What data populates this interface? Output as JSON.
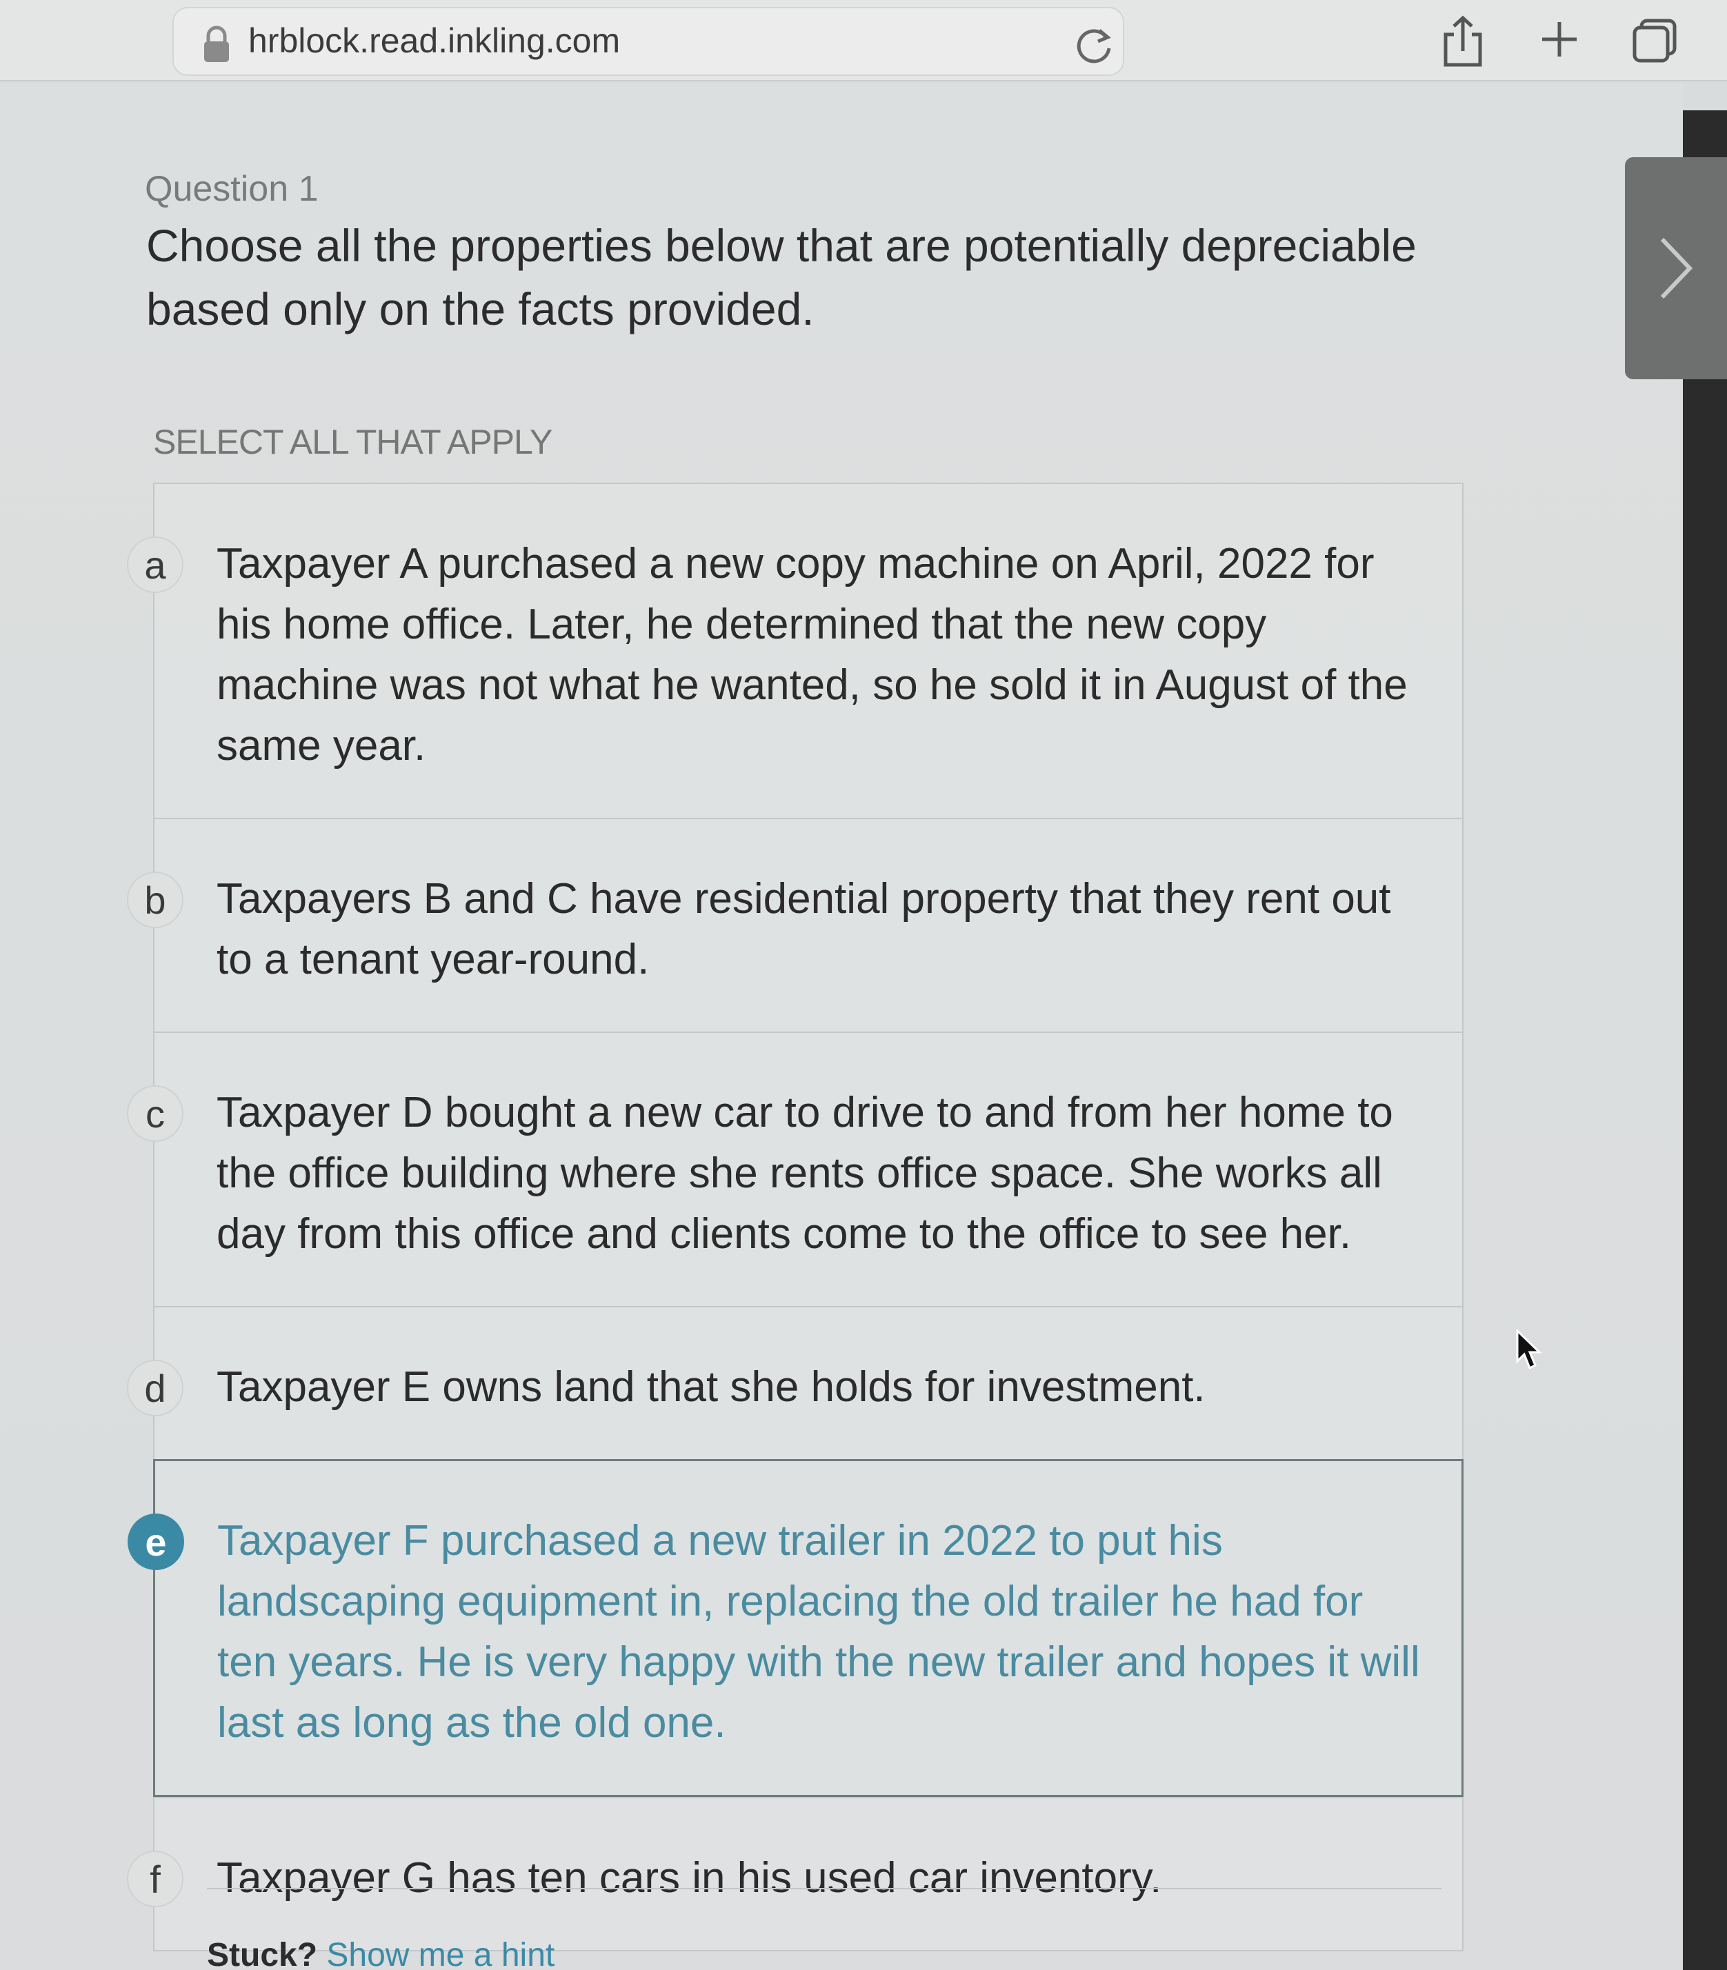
{
  "browser": {
    "url": "hrblock.read.inkling.com",
    "icons": [
      "lock-icon",
      "reload-icon",
      "share-icon",
      "plus-icon",
      "tabs-icon"
    ]
  },
  "question": {
    "label": "Question 1",
    "text": "Choose all the properties below that are potentially depreciable based only on the facts provided.",
    "instruction": "SELECT ALL THAT APPLY"
  },
  "options": [
    {
      "letter": "a",
      "text": "Taxpayer A purchased a new copy machine on April, 2022 for his home office. Later, he determined that the new copy machine was not what he wanted, so he sold it in August of the same year.",
      "selected": false
    },
    {
      "letter": "b",
      "text": "Taxpayers B and C have residential property that they rent out to a tenant year-round.",
      "selected": false
    },
    {
      "letter": "c",
      "text": "Taxpayer D bought a new car to drive to and from her home to the office building where she rents office space. She works all day from this office and clients come to the office to see her.",
      "selected": false
    },
    {
      "letter": "d",
      "text": "Taxpayer E owns land that she holds for investment.",
      "selected": false
    },
    {
      "letter": "e",
      "text": "Taxpayer F purchased a new trailer in 2022 to put his landscaping equipment in, replacing the old trailer he had for ten years. He is very happy with the new trailer and hopes it will last as long as the old one.",
      "selected": true
    },
    {
      "letter": "f",
      "text": "Taxpayer G has ten cars in his used car inventory.",
      "selected": false
    }
  ],
  "hint": {
    "stuck": "Stuck?",
    "link": "Show me a hint"
  },
  "colors": {
    "accent": "#3a8aa6",
    "selected_text": "#4a8ba0",
    "page_bg": "#dcdfdf"
  }
}
